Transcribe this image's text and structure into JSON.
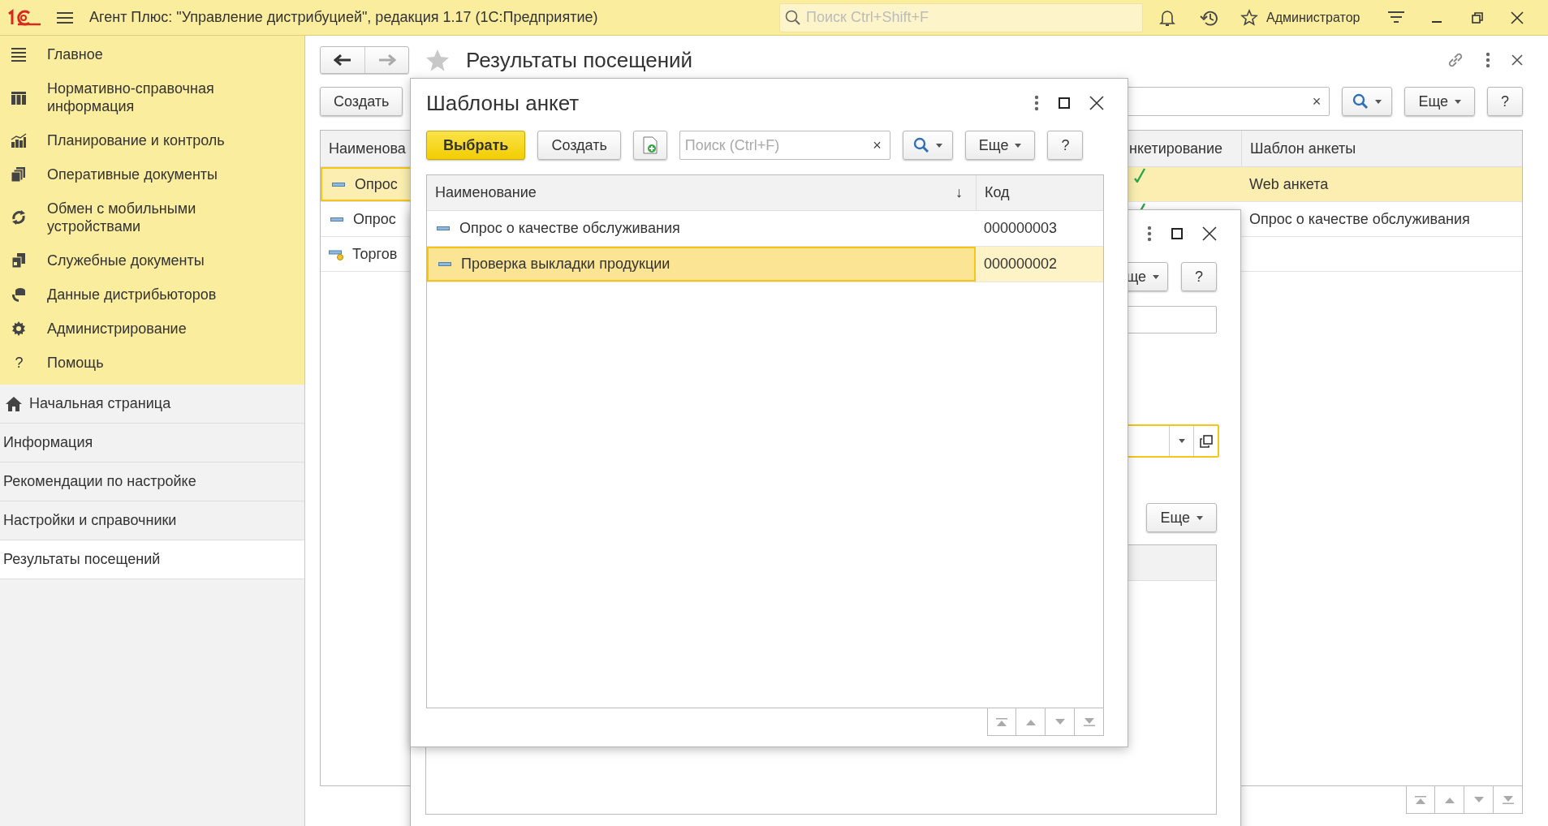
{
  "app_bar": {
    "title": "Агент Плюс: \"Управление дистрибуцией\", редакция 1.17  (1С:Предприятие)",
    "search": {
      "placeholder": "Поиск Ctrl+Shift+F"
    },
    "user": "Администратор"
  },
  "sidebar": {
    "sections": [
      {
        "label": "Главное"
      },
      {
        "label": "Нормативно-справочная информация"
      },
      {
        "label": "Планирование и контроль"
      },
      {
        "label": "Оперативные документы"
      },
      {
        "label": "Обмен с мобильными устройствами"
      },
      {
        "label": "Служебные документы"
      },
      {
        "label": "Данные дистрибьюторов"
      },
      {
        "label": "Администрирование"
      },
      {
        "label": "Помощь",
        "icon": "?"
      }
    ],
    "open_windows": [
      {
        "label": "Начальная страница",
        "selected": false
      },
      {
        "label": "Информация",
        "selected": false
      },
      {
        "label": "Рекомендации по настройке",
        "selected": false
      },
      {
        "label": "Настройки и справочники",
        "selected": false
      },
      {
        "label": "Результаты посещений",
        "selected": true
      }
    ]
  },
  "main_window": {
    "title": "Результаты посещений",
    "create_button": "Создать",
    "more_button": "Еще",
    "help_button": "?",
    "clear_button": "×",
    "table": {
      "columns": [
        "Наименова",
        "нкетирование",
        "Шаблон анкеты"
      ],
      "rows": [
        {
          "name": "Опрос",
          "checked": true,
          "template": "Web анкета",
          "selected": true,
          "kind": "plain"
        },
        {
          "name": "Опрос",
          "checked": true,
          "template": "Опрос о качестве обслуживания",
          "selected": false,
          "kind": "plain"
        },
        {
          "name": "Торгов",
          "template": "",
          "selected": false,
          "kind": "flagged"
        }
      ]
    }
  },
  "back_dialog": {
    "more_button": "ще",
    "help_button": "?",
    "more_button_2": "Еще"
  },
  "dialog": {
    "title": "Шаблоны анкет",
    "select_button": "Выбрать",
    "create_button": "Создать",
    "search": {
      "placeholder": "Поиск (Ctrl+F)"
    },
    "clear_button": "×",
    "more_button": "Еще",
    "help_button": "?",
    "table": {
      "columns": [
        "Наименование",
        "Код"
      ],
      "sort_mark": "↓",
      "rows": [
        {
          "name": "Опрос о качестве обслуживания",
          "code": "000000003",
          "selected": false
        },
        {
          "name": "Проверка выкладки продукции",
          "code": "000000002",
          "selected": true
        }
      ]
    }
  }
}
